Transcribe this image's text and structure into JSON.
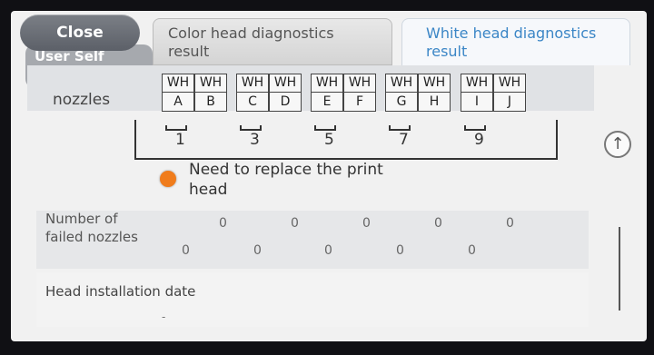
{
  "header": {
    "close_label": "Close",
    "mode_label": "User Self Repair Mode"
  },
  "tabs": [
    {
      "label": "Color head diagnostics result",
      "active": false
    },
    {
      "label": "White head diagnostics result",
      "active": true
    }
  ],
  "nozzles": {
    "label": "nozzles",
    "heads": [
      {
        "wh": "WH",
        "letter": "A"
      },
      {
        "wh": "WH",
        "letter": "B"
      },
      {
        "wh": "WH",
        "letter": "C"
      },
      {
        "wh": "WH",
        "letter": "D"
      },
      {
        "wh": "WH",
        "letter": "E"
      },
      {
        "wh": "WH",
        "letter": "F"
      },
      {
        "wh": "WH",
        "letter": "G"
      },
      {
        "wh": "WH",
        "letter": "H"
      },
      {
        "wh": "WH",
        "letter": "I"
      },
      {
        "wh": "WH",
        "letter": "J"
      }
    ],
    "group_numbers": [
      "1",
      "3",
      "5",
      "7",
      "9"
    ]
  },
  "status": {
    "text": "Need to replace the print head",
    "color": "#f07c1c"
  },
  "failed_nozzles": {
    "label": "Number of failed nozzles",
    "row1": [
      "0",
      "0",
      "0",
      "0",
      "0"
    ],
    "row2": [
      "0",
      "0",
      "0",
      "0",
      "0"
    ]
  },
  "head_installation": {
    "label": "Head installation date",
    "value": "-"
  },
  "icons": {
    "scroll_up": "arrow-up-circle-icon"
  }
}
